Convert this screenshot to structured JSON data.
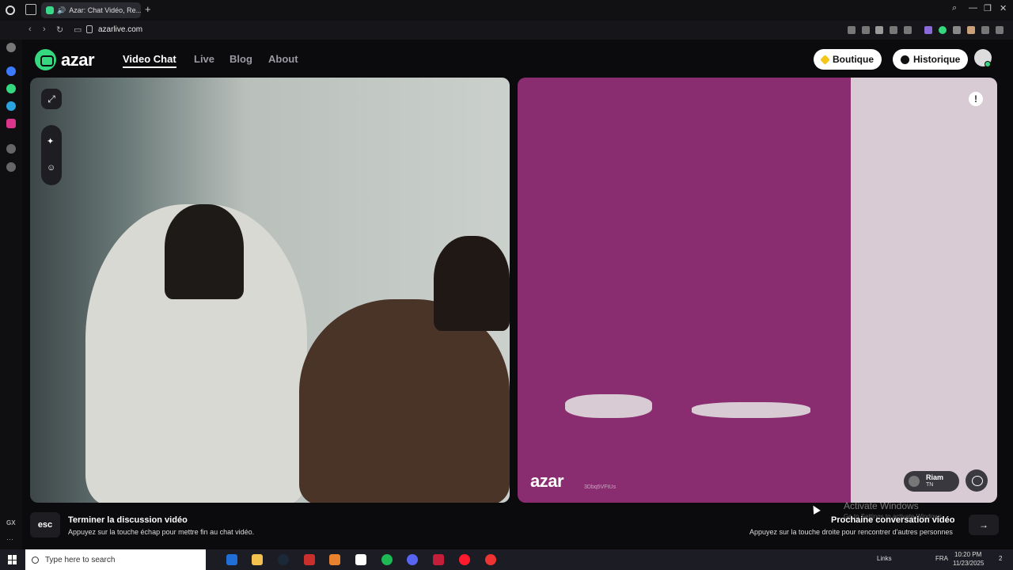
{
  "browser": {
    "tab_title": "Azar: Chat Vidéo, Re...",
    "url": "azarlive.com"
  },
  "site": {
    "logo_text": "azar",
    "nav": [
      "Video Chat",
      "Live",
      "Blog",
      "About"
    ],
    "boutique_label": "Boutique",
    "historique_label": "Historique"
  },
  "partner_video": {
    "watermark": "azar",
    "watermark_id": "3Dbq5VFtUs",
    "partner_name": "Riam",
    "partner_country": "TN"
  },
  "hints": {
    "esc_key": "esc",
    "end_title": "Terminer la discussion vidéo",
    "end_sub": "Appuyez sur la touche échap pour mettre fin au chat vidéo.",
    "next_title": "Prochaine conversation vidéo",
    "next_sub": "Appuyez sur la touche droite pour rencontrer d'autres personnes",
    "next_key": "→"
  },
  "os_overlay": {
    "activate_title": "Activate Windows",
    "activate_sub": "Go to Settings to activate Windows."
  },
  "taskbar": {
    "search_placeholder": "Type here to search",
    "tray_links": "Links",
    "tray_lang": "FRA",
    "time": "10:20 PM",
    "date": "11/23/2025",
    "notif_count": "2"
  },
  "colors": {
    "brand_green": "#35d87e",
    "partner_bg": "#8a2c70"
  }
}
